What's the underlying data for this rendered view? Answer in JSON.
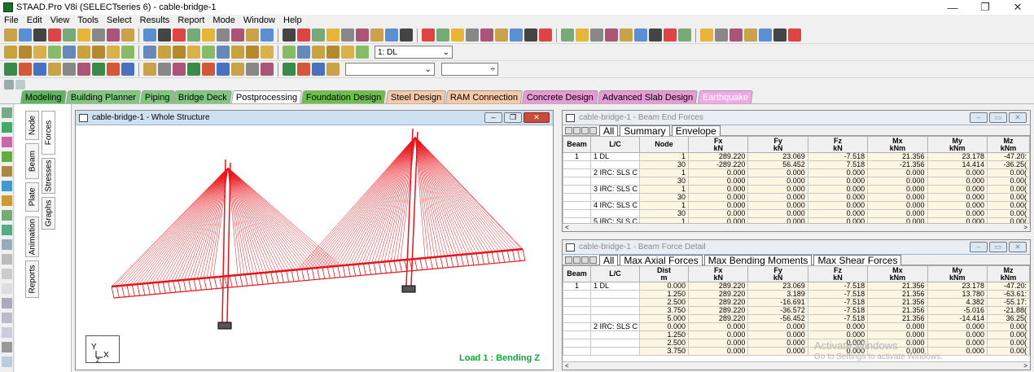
{
  "window": {
    "title": "STAAD.Pro V8i (SELECTseries 6) - cable-bridge-1",
    "minimize": "—",
    "maximize": "❐",
    "close": "✕"
  },
  "menu": [
    "File",
    "Edit",
    "View",
    "Tools",
    "Select",
    "Results",
    "Report",
    "Mode",
    "Window",
    "Help"
  ],
  "toolbar": {
    "load_combo": "1: DL"
  },
  "page_tabs": [
    {
      "label": "Modeling",
      "color": "#5cb85c"
    },
    {
      "label": "Building Planner",
      "color": "#7fc97f"
    },
    {
      "label": "Piping",
      "color": "#7fc97f"
    },
    {
      "label": "Bridge Deck",
      "color": "#7fc97f"
    },
    {
      "label": "Postprocessing",
      "color": "#ffffff"
    },
    {
      "label": "Foundation Design",
      "color": "#6cc04a"
    },
    {
      "label": "Steel Design",
      "color": "#f6c9a8"
    },
    {
      "label": "RAM Connection",
      "color": "#f6c9a8"
    },
    {
      "label": "Concrete Design",
      "color": "#e89ad6"
    },
    {
      "label": "Advanced Slab Design",
      "color": "#e89ad6"
    },
    {
      "label": "Earthquake",
      "color": "#f0a8e8"
    }
  ],
  "side_tabs": {
    "node": "Node",
    "beam": "Beam",
    "plate": "Plate",
    "animation": "Animation",
    "reports": "Reports",
    "forces": "Forces",
    "stresses": "Stresses",
    "graphs": "Graphs"
  },
  "viewport": {
    "title": "cable-bridge-1 - Whole Structure",
    "load_label": "Load 1 : Bending Z",
    "axis_y": "Y",
    "axis_x": "X",
    "axis_z": "Z"
  },
  "beam_end": {
    "title": "cable-bridge-1 - Beam End Forces",
    "tabs": [
      "All",
      "Summary",
      "Envelope"
    ],
    "headers": [
      {
        "top": "Beam",
        "unit": ""
      },
      {
        "top": "L/C",
        "unit": ""
      },
      {
        "top": "Node",
        "unit": ""
      },
      {
        "top": "Fx",
        "unit": "kN"
      },
      {
        "top": "Fy",
        "unit": "kN"
      },
      {
        "top": "Fz",
        "unit": "kN"
      },
      {
        "top": "Mx",
        "unit": "kNm"
      },
      {
        "top": "My",
        "unit": "kNm"
      },
      {
        "top": "Mz",
        "unit": "kNm"
      }
    ],
    "rows": [
      [
        "1",
        "1 DL",
        "1",
        "289.220",
        "23.069",
        "-7.518",
        "21.356",
        "23.178",
        "-47.20:"
      ],
      [
        "",
        "",
        "30",
        "-289.220",
        "56.452",
        "7.518",
        "-21.356",
        "14.414",
        "-36.25("
      ],
      [
        "",
        "2 IRC: SLS C",
        "1",
        "0.000",
        "0.000",
        "0.000",
        "0.000",
        "0.000",
        "0.00("
      ],
      [
        "",
        "",
        "30",
        "0.000",
        "0.000",
        "0.000",
        "0.000",
        "0.000",
        "0.00("
      ],
      [
        "",
        "3 IRC: SLS C",
        "1",
        "0.000",
        "0.000",
        "0.000",
        "0.000",
        "0.000",
        "0.00("
      ],
      [
        "",
        "",
        "30",
        "0.000",
        "0.000",
        "0.000",
        "0.000",
        "0.000",
        "0.00("
      ],
      [
        "",
        "4 IRC: SLS C",
        "1",
        "0.000",
        "0.000",
        "0.000",
        "0.000",
        "0.000",
        "0.00("
      ],
      [
        "",
        "",
        "30",
        "0.000",
        "0.000",
        "0.000",
        "0.000",
        "0.000",
        "0.00("
      ],
      [
        "",
        "5 IRC: SLS C",
        "1",
        "0.000",
        "0.000",
        "0.000",
        "0.000",
        "0.000",
        "0.00("
      ]
    ]
  },
  "beam_force": {
    "title": "cable-bridge-1 - Beam Force Detail",
    "tabs": [
      "All",
      "Max Axial Forces",
      "Max Bending Moments",
      "Max Shear Forces"
    ],
    "headers": [
      {
        "top": "Beam",
        "unit": ""
      },
      {
        "top": "L/C",
        "unit": ""
      },
      {
        "top": "Dist",
        "unit": "m"
      },
      {
        "top": "Fx",
        "unit": "kN"
      },
      {
        "top": "Fy",
        "unit": "kN"
      },
      {
        "top": "Fz",
        "unit": "kN"
      },
      {
        "top": "Mx",
        "unit": "kNm"
      },
      {
        "top": "My",
        "unit": "kNm"
      },
      {
        "top": "Mz",
        "unit": "kNm"
      }
    ],
    "rows": [
      [
        "1",
        "1 DL",
        "0.000",
        "289.220",
        "23.069",
        "-7.518",
        "21.356",
        "23.178",
        "-47.20:"
      ],
      [
        "",
        "",
        "1.250",
        "289.220",
        "3.189",
        "-7.518",
        "21.356",
        "13.780",
        "-63.61:"
      ],
      [
        "",
        "",
        "2.500",
        "289.220",
        "-16.691",
        "-7.518",
        "21.356",
        "4.382",
        "-55.17:"
      ],
      [
        "",
        "",
        "3.750",
        "289.220",
        "-36.572",
        "-7.518",
        "21.356",
        "-5.016",
        "-21.88("
      ],
      [
        "",
        "",
        "5.000",
        "289.220",
        "-56.452",
        "-7.518",
        "21.356",
        "-14.414",
        "36.25("
      ],
      [
        "",
        "2 IRC: SLS C",
        "0.000",
        "0.000",
        "0.000",
        "0.000",
        "0.000",
        "0.000",
        "0.00("
      ],
      [
        "",
        "",
        "1.250",
        "0.000",
        "0.000",
        "0.000",
        "0.000",
        "0.000",
        "0.00("
      ],
      [
        "",
        "",
        "2.500",
        "0.000",
        "0.000",
        "0.000",
        "0.000",
        "0.000",
        "0.00("
      ],
      [
        "",
        "",
        "3.750",
        "0.000",
        "0.000",
        "0.000",
        "0.000",
        "0.000",
        "0.00("
      ]
    ]
  },
  "watermark": {
    "line1": "Activate Windows",
    "line2": "Go to Settings to activate Windows."
  }
}
